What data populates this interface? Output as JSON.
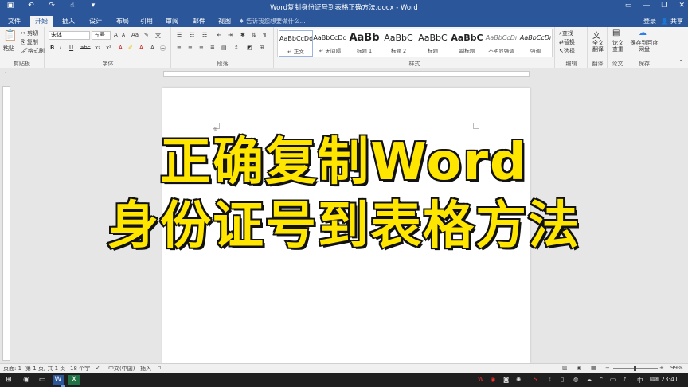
{
  "window": {
    "title": "Word复制身份证号到表格正确方法.docx - Word",
    "controls": [
      "restore-icon",
      "minimize-icon",
      "maximize-icon",
      "close-icon"
    ]
  },
  "qat": [
    "save-icon",
    "undo-icon",
    "redo-icon",
    "touch-mode-icon",
    "more-icon"
  ],
  "tabs": [
    "文件",
    "开始",
    "插入",
    "设计",
    "布局",
    "引用",
    "审阅",
    "邮件",
    "视图"
  ],
  "tell_me": "告诉我您想要做什么...",
  "login": "登录",
  "share": "共享",
  "ribbon": {
    "clipboard": {
      "paste": "粘贴",
      "cut": "剪切",
      "copy": "复制",
      "format_painter": "格式刷",
      "label": "剪贴板"
    },
    "font": {
      "name": "宋体",
      "size": "五号",
      "grow": "A",
      "shrink": "A",
      "aa": "Aa",
      "bold": "B",
      "italic": "I",
      "underline": "U",
      "strike": "abc",
      "sub": "x₂",
      "sup": "x²",
      "label": "字体"
    },
    "paragraph": {
      "label": "段落"
    },
    "styles": {
      "label": "样式",
      "items": [
        {
          "preview": "AaBbCcDd",
          "name": "↵ 正文"
        },
        {
          "preview": "AaBbCcDd",
          "name": "↵ 无间隔"
        },
        {
          "preview": "AaBb",
          "name": "标题 1"
        },
        {
          "preview": "AaBbC",
          "name": "标题 2"
        },
        {
          "preview": "AaBbC",
          "name": "标题"
        },
        {
          "preview": "AaBbC",
          "name": "副标题"
        },
        {
          "preview": "AaBbCcDı",
          "name": "不明显强调"
        },
        {
          "preview": "AaBbCcDı",
          "name": "强调"
        }
      ]
    },
    "editing": {
      "find": "查找",
      "replace": "替换",
      "select": "选择",
      "label": "编辑"
    },
    "translate": {
      "button": "全文翻译",
      "label": "翻译"
    },
    "paper": {
      "button": "论文查重",
      "label": "论文"
    },
    "save": {
      "button": "保存到百度网盘",
      "label": "保存"
    }
  },
  "headline": {
    "line1": "正确复制Word",
    "line2": "身份证号到表格方法"
  },
  "status": {
    "page": "页面: 1",
    "section": "第 1 页, 共 1 页",
    "words": "18 个字",
    "lang": "中文(中国)",
    "mode": "插入",
    "zoom": "99%"
  },
  "taskbar": {
    "time": "23:41",
    "ime": "中"
  },
  "colors": {
    "brand": "#2b579a",
    "headline": "#ffe600"
  }
}
